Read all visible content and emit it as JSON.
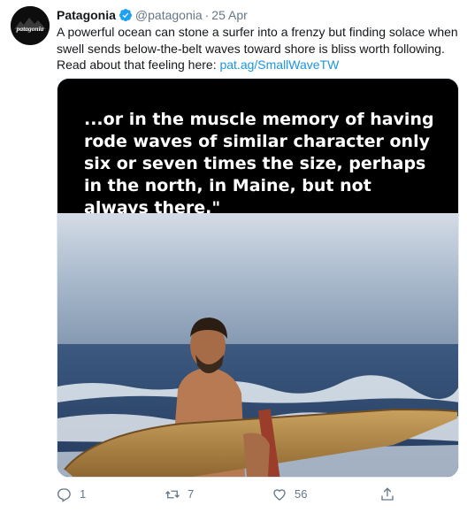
{
  "tweet": {
    "author_name": "Patagonia",
    "author_handle": "@patagonia",
    "separator": "·",
    "date": "25 Apr",
    "avatar_text": "patagonia",
    "text": "A powerful ocean can stone a surfer into a frenzy but finding solace when swell sends below-the-belt waves toward shore is bliss worth following. Read about that feeling here: ",
    "link_text": "pat.ag/SmallWaveTW"
  },
  "media": {
    "quote": "...or in the muscle memory of having rode waves of similar character only six or seven times the size, perhaps in the north, in Maine, but not always there.\""
  },
  "actions": {
    "reply_count": "1",
    "retweet_count": "7",
    "like_count": "56"
  },
  "colors": {
    "link": "#1b95e0",
    "muted": "#657786",
    "verified": "#1da1f2"
  },
  "icons": [
    "verified-badge-icon",
    "reply-icon",
    "retweet-icon",
    "like-icon",
    "share-icon"
  ]
}
